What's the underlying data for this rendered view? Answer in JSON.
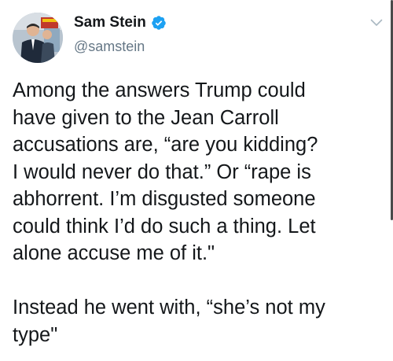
{
  "author": {
    "display_name": "Sam Stein",
    "handle": "@samstein",
    "verified": true,
    "avatar_icon": "profile-photo"
  },
  "tweet": {
    "lines": [
      "Among the answers Trump could",
      "have given to the Jean Carroll",
      "accusations are, “are you kidding?",
      "I would never do that.” Or “rape is",
      "abhorrent. I’m disgusted someone",
      "could think I’d do such a thing. Let",
      "alone accuse me of it.\"",
      "",
      "Instead he went with, “she’s not my",
      "type\""
    ]
  },
  "colors": {
    "text": "#14171a",
    "secondary_text": "#657786",
    "verified_badge": "#1da1f2",
    "caret": "#aab8c2"
  },
  "icons": {
    "verified": "verified-badge-icon",
    "more": "chevron-down-icon"
  }
}
